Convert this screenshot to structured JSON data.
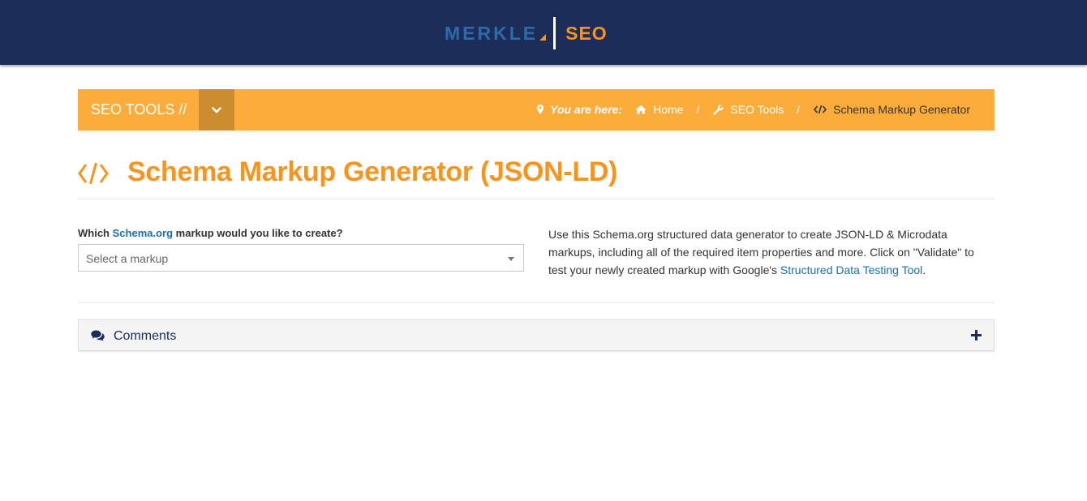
{
  "header": {
    "logo_merkle": "MERKLE",
    "logo_seo": "SEO",
    "bg_color": "#1c2d5a"
  },
  "toolbar": {
    "title": "SEO TOOLS //",
    "toggle_icon": "chevron-down-icon",
    "bg_color": "#fbac3b",
    "breadcrumb": {
      "prefix": "You are here:",
      "items": [
        {
          "label": "Home",
          "icon": "home-icon"
        },
        {
          "label": "SEO Tools",
          "icon": "wrench-icon"
        },
        {
          "label": "Schema Markup Generator",
          "icon": "code-icon"
        }
      ],
      "separator": "/"
    }
  },
  "main": {
    "title": "Schema Markup Generator (JSON-LD)",
    "title_icon": "code-icon",
    "accent_color": "#f7941d",
    "form": {
      "label_prefix": "Which",
      "label_link": "Schema.org",
      "label_suffix": "markup would you like to create?",
      "select_placeholder": "Select a markup"
    },
    "description": {
      "text": "Use this Schema.org structured data generator to create JSON-LD & Microdata markups, including all of the required item properties and more. Click on \"Validate\" to test your newly created markup with Google's",
      "link": "Structured Data Testing Tool",
      "end": "."
    },
    "comments": {
      "label": "Comments",
      "icon": "comments-icon",
      "expand_icon": "plus-icon"
    }
  }
}
